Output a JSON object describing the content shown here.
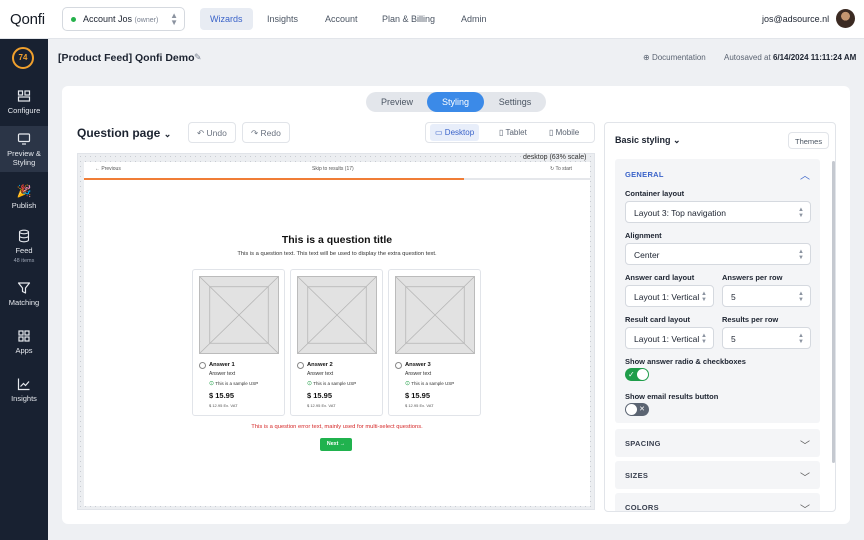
{
  "app": {
    "logo": "Qonfi"
  },
  "account": {
    "name": "Account Jos",
    "role": "(owner)"
  },
  "topnav": [
    "Wizards",
    "Insights",
    "Account",
    "Plan & Billing",
    "Admin"
  ],
  "user": {
    "email": "jos@adsource.nl"
  },
  "sidebar": {
    "score": "74",
    "items": [
      {
        "label": "Configure",
        "icon": "configure-icon"
      },
      {
        "label": "Preview & Styling",
        "icon": "monitor-icon"
      },
      {
        "label": "Publish",
        "icon": "party-popper-icon"
      },
      {
        "label": "Feed",
        "sub": "48 items",
        "icon": "database-icon"
      },
      {
        "label": "Matching",
        "icon": "funnel-icon"
      },
      {
        "label": "Apps",
        "icon": "grid-icon"
      },
      {
        "label": "Insights",
        "icon": "line-chart-icon"
      }
    ]
  },
  "header": {
    "title": "[Product Feed] Qonfi Demo",
    "documentation": "Documentation",
    "autosave_prefix": "Autosaved at",
    "autosave_time": "6/14/2024 11:11:24 AM"
  },
  "tabs": [
    "Preview",
    "Styling",
    "Settings"
  ],
  "toolbar": {
    "page_select": "Question page",
    "undo": "Undo",
    "redo": "Redo",
    "devices": [
      "Desktop",
      "Tablet",
      "Mobile"
    ],
    "scale": "desktop (63% scale)"
  },
  "preview": {
    "previous": "← Previous",
    "skip": "Skip to results (17)",
    "to_start": "To start",
    "progress": 0.75,
    "question_title": "This is a question title",
    "question_text": "This is a question text. This text will be used to display the extra question text.",
    "answers": [
      {
        "name": "Answer 1",
        "text": "Answer text",
        "usp": "This is a sample USP",
        "price": "$ 15.95",
        "vat": "$ 12.95 Ex. VAT"
      },
      {
        "name": "Answer 2",
        "text": "Answer text",
        "usp": "This is a sample USP",
        "price": "$ 15.95",
        "vat": "$ 12.95 Ex. VAT"
      },
      {
        "name": "Answer 3",
        "text": "Answer text",
        "usp": "This is a sample USP",
        "price": "$ 15.95",
        "vat": "$ 12.95 Ex. VAT"
      }
    ],
    "error": "This is a question error text, mainly used for multi-select questions.",
    "next": "Next →"
  },
  "styling": {
    "title": "Basic styling",
    "themes": "Themes",
    "general": {
      "header": "GENERAL",
      "container_layout_label": "Container layout",
      "container_layout": "Layout 3: Top navigation",
      "alignment_label": "Alignment",
      "alignment": "Center",
      "answer_card_layout_label": "Answer card layout",
      "answer_card_layout": "Layout 1: Vertical",
      "answers_per_row_label": "Answers per row",
      "answers_per_row": "5",
      "result_card_layout_label": "Result card layout",
      "result_card_layout": "Layout 1: Vertical",
      "results_per_row_label": "Results per row",
      "results_per_row": "5",
      "radio_label": "Show answer radio & checkboxes",
      "radio_on": true,
      "email_label": "Show email results button",
      "email_on": false
    },
    "sections": [
      "SPACING",
      "SIZES",
      "COLORS"
    ]
  },
  "colors": {
    "accent": "#3b8ae8",
    "sidebar": "#182131",
    "progress": "#f07d36",
    "next": "#20b24e",
    "error": "#d52828",
    "score": "#f0a02d"
  }
}
